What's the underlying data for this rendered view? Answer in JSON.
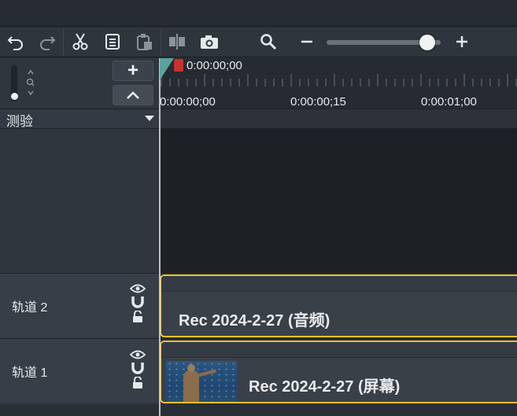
{
  "toolbar": {
    "buttons": [
      "undo-icon",
      "redo-icon",
      "cut-icon",
      "copy-icon",
      "paste-icon",
      "split-icon",
      "snapshot-icon",
      "zoom-icon",
      "zoom-out-icon",
      "zoom-in-icon"
    ]
  },
  "zoom": {
    "level": 0.88
  },
  "track_controls": {
    "add_label": "+",
    "collapse_label": "^"
  },
  "marker_track": {
    "label": "测验"
  },
  "playhead": {
    "timecode": "0:00:00;00"
  },
  "ruler": {
    "ticks": [
      "0:00:00;00",
      "0:00:00;15",
      "0:00:01;00"
    ]
  },
  "tracks": [
    {
      "name": "轨道 2",
      "clip_title": "Rec 2024-2-27 (音频)"
    },
    {
      "name": "轨道 1",
      "clip_title": "Rec 2024-2-27 (屏幕)"
    }
  ],
  "colors": {
    "clip_border": "#f0c02f",
    "playhead_marker": "#c8312c",
    "playhead_flag": "#5aa39d"
  }
}
